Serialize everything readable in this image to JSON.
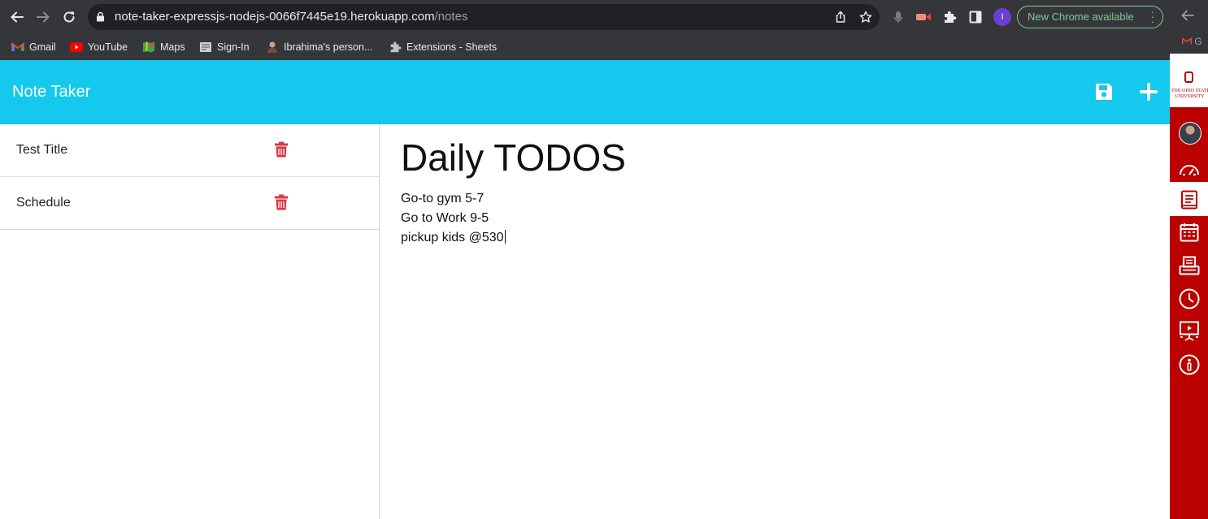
{
  "browser": {
    "url_host": "note-taker-expressjs-nodejs-0066f7445e19.herokuapp.com",
    "url_path": "/notes",
    "profile_initial": "I",
    "update_label": "New Chrome available",
    "bookmarks": [
      {
        "label": "Gmail",
        "icon": "gmail-icon"
      },
      {
        "label": "YouTube",
        "icon": "youtube-icon"
      },
      {
        "label": "Maps",
        "icon": "maps-icon"
      },
      {
        "label": "Sign-In",
        "icon": "signin-icon"
      },
      {
        "label": "Ibrahima's person...",
        "icon": "person-icon"
      },
      {
        "label": "Extensions - Sheets",
        "icon": "puzzle-icon"
      }
    ],
    "overflow_bookmark": "G"
  },
  "app": {
    "brand": "Note Taker",
    "notes": [
      {
        "title": "Test Title"
      },
      {
        "title": "Schedule"
      }
    ],
    "active_note": {
      "title": "Daily TODOS",
      "lines": [
        "Go-to gym 5-7",
        "Go to Work 9-5",
        "pickup kids @530"
      ]
    },
    "colors": {
      "header": "#15c8ee",
      "trash": "#dc3545",
      "side_panel": "#bb0000"
    }
  },
  "side_panel": {
    "logo_lines": [
      "THE OHIO STATE",
      "UNIVERSITY"
    ],
    "icons": [
      "avatar",
      "dashboard-icon",
      "notebook-icon",
      "calendar-icon",
      "printer-icon",
      "clock-icon",
      "presentation-icon",
      "info-icon"
    ]
  }
}
